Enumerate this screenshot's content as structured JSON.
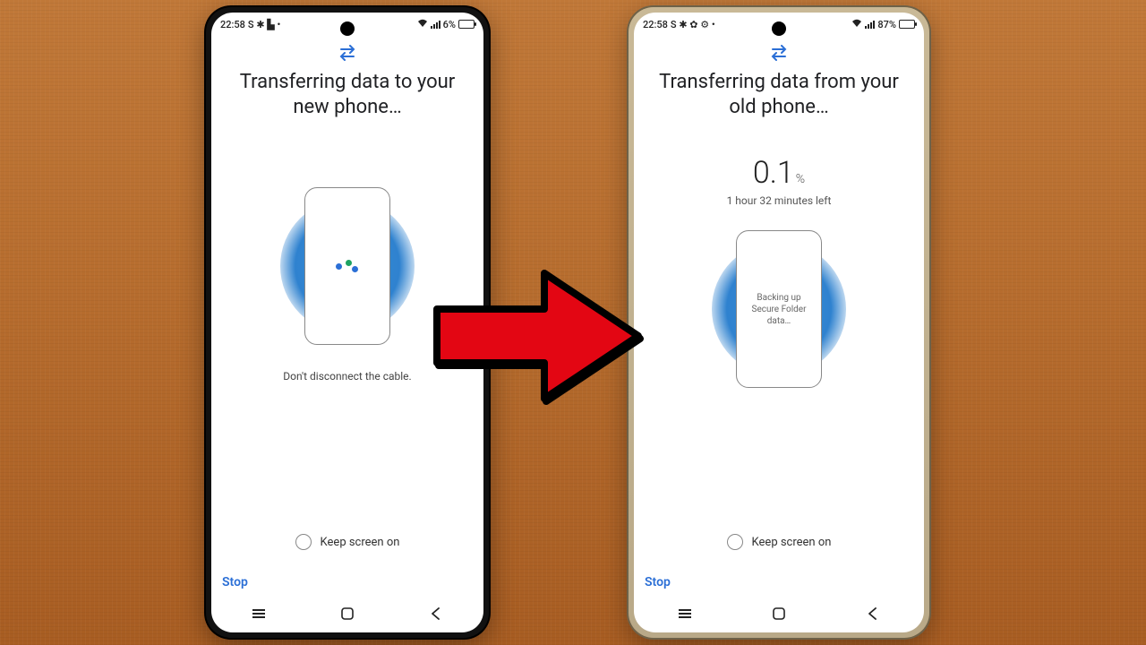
{
  "phone_left": {
    "status": {
      "time": "22:58",
      "icons_left": "S ✱ ▙ •",
      "signal_label": "signal",
      "battery_pct": "6%",
      "battery_fill_pct": 8
    },
    "title": "Transferring data to your new phone…",
    "hint": "Don't disconnect the cable.",
    "keep_screen_label": "Keep screen on",
    "stop_label": "Stop"
  },
  "phone_right": {
    "status": {
      "time": "22:58",
      "icons_left": "S ✱ ✿ ⚙ •",
      "signal_label": "signal",
      "battery_pct": "87%",
      "battery_fill_pct": 87
    },
    "title": "Transferring data from your old phone…",
    "progress_value": "0.1",
    "progress_unit": "%",
    "time_left": "1 hour 32 minutes left",
    "device_status": "Backing up Secure Folder data…",
    "keep_screen_label": "Keep screen on",
    "stop_label": "Stop"
  }
}
